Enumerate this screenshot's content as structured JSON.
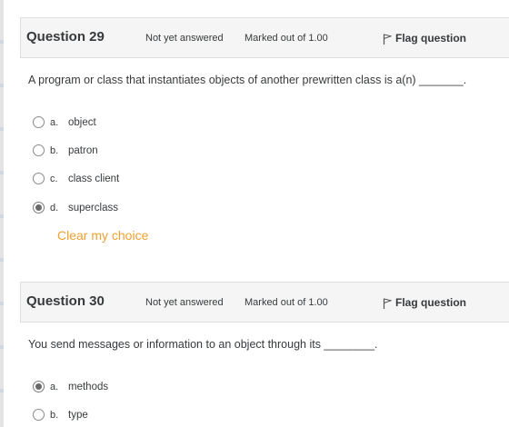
{
  "questions": [
    {
      "number": "Question 29",
      "state": "Not yet answered",
      "grade": "Marked out of 1.00",
      "flag_label": "Flag question",
      "text": "A program or class that instantiates objects of another prewritten class is a(n) _______.",
      "options": [
        {
          "letter": "a.",
          "text": "object",
          "selected": false
        },
        {
          "letter": "b.",
          "text": "patron",
          "selected": false
        },
        {
          "letter": "c.",
          "text": "class client",
          "selected": false
        },
        {
          "letter": "d.",
          "text": "superclass",
          "selected": true
        }
      ],
      "clear_label": "Clear my choice"
    },
    {
      "number": "Question 30",
      "state": "Not yet answered",
      "grade": "Marked out of 1.00",
      "flag_label": "Flag question",
      "text": "You send messages or information to an object through its ________.",
      "options": [
        {
          "letter": "a.",
          "text": "methods",
          "selected": true
        },
        {
          "letter": "b.",
          "text": "type",
          "selected": false
        }
      ]
    }
  ],
  "colors": {
    "clear_link": "#f0a030",
    "info_bg": "#f5f5f5"
  }
}
